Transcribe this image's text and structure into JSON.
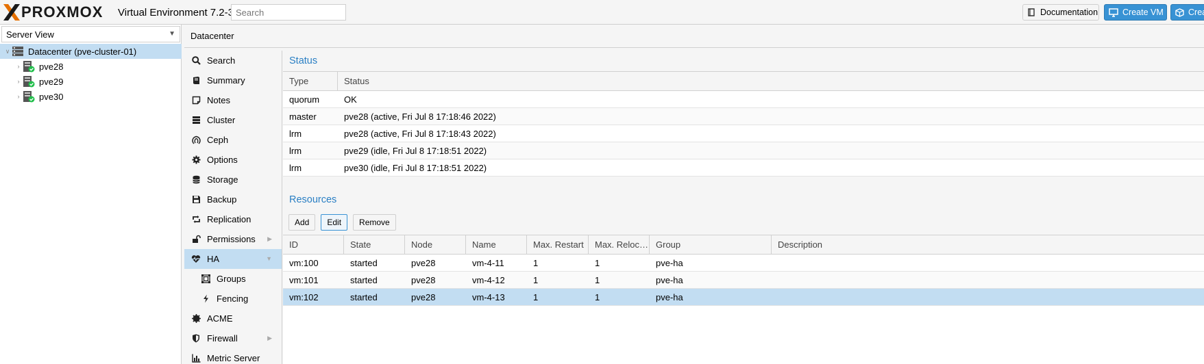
{
  "header": {
    "logo_text": "PROXMOX",
    "version": "Virtual Environment 7.2-3",
    "search_placeholder": "Search",
    "documentation_label": "Documentation",
    "create_vm_label": "Create VM",
    "create_ct_label": "Crea"
  },
  "tree": {
    "view_label": "Server View",
    "datacenter_label": "Datacenter (pve-cluster-01)",
    "nodes": [
      "pve28",
      "pve29",
      "pve30"
    ]
  },
  "breadcrumb": "Datacenter",
  "nav": {
    "items": [
      {
        "label": "Search",
        "icon": "search-icon"
      },
      {
        "label": "Summary",
        "icon": "book-icon"
      },
      {
        "label": "Notes",
        "icon": "sticky-note-icon"
      },
      {
        "label": "Cluster",
        "icon": "server-icon"
      },
      {
        "label": "Ceph",
        "icon": "ceph-icon"
      },
      {
        "label": "Options",
        "icon": "gear-icon"
      },
      {
        "label": "Storage",
        "icon": "database-icon"
      },
      {
        "label": "Backup",
        "icon": "floppy-icon"
      },
      {
        "label": "Replication",
        "icon": "retweet-icon"
      },
      {
        "label": "Permissions",
        "icon": "unlock-icon"
      },
      {
        "label": "HA",
        "icon": "heartbeat-icon"
      },
      {
        "label": "Groups",
        "icon": "groups-icon"
      },
      {
        "label": "Fencing",
        "icon": "bolt-icon"
      },
      {
        "label": "ACME",
        "icon": "certificate-icon"
      },
      {
        "label": "Firewall",
        "icon": "shield-icon"
      },
      {
        "label": "Metric Server",
        "icon": "bar-chart-icon"
      }
    ]
  },
  "status": {
    "title": "Status",
    "columns": [
      "Type",
      "Status"
    ],
    "rows": [
      [
        "quorum",
        "OK"
      ],
      [
        "master",
        "pve28 (active, Fri Jul 8 17:18:46 2022)"
      ],
      [
        "lrm",
        "pve28 (active, Fri Jul 8 17:18:43 2022)"
      ],
      [
        "lrm",
        "pve29 (idle, Fri Jul 8 17:18:51 2022)"
      ],
      [
        "lrm",
        "pve30 (idle, Fri Jul 8 17:18:51 2022)"
      ]
    ]
  },
  "resources": {
    "title": "Resources",
    "add_label": "Add",
    "edit_label": "Edit",
    "remove_label": "Remove",
    "columns": [
      "ID",
      "State",
      "Node",
      "Name",
      "Max. Restart",
      "Max. Reloc…",
      "Group",
      "Description"
    ],
    "rows": [
      [
        "vm:100",
        "started",
        "pve28",
        "vm-4-11",
        "1",
        "1",
        "pve-ha",
        ""
      ],
      [
        "vm:101",
        "started",
        "pve28",
        "vm-4-12",
        "1",
        "1",
        "pve-ha",
        ""
      ],
      [
        "vm:102",
        "started",
        "pve28",
        "vm-4-13",
        "1",
        "1",
        "pve-ha",
        ""
      ]
    ]
  },
  "colors": {
    "accent": "#3892d4",
    "selection": "#c2ddf2",
    "title_blue": "#2a7fc4",
    "logo_orange": "#e57000"
  }
}
